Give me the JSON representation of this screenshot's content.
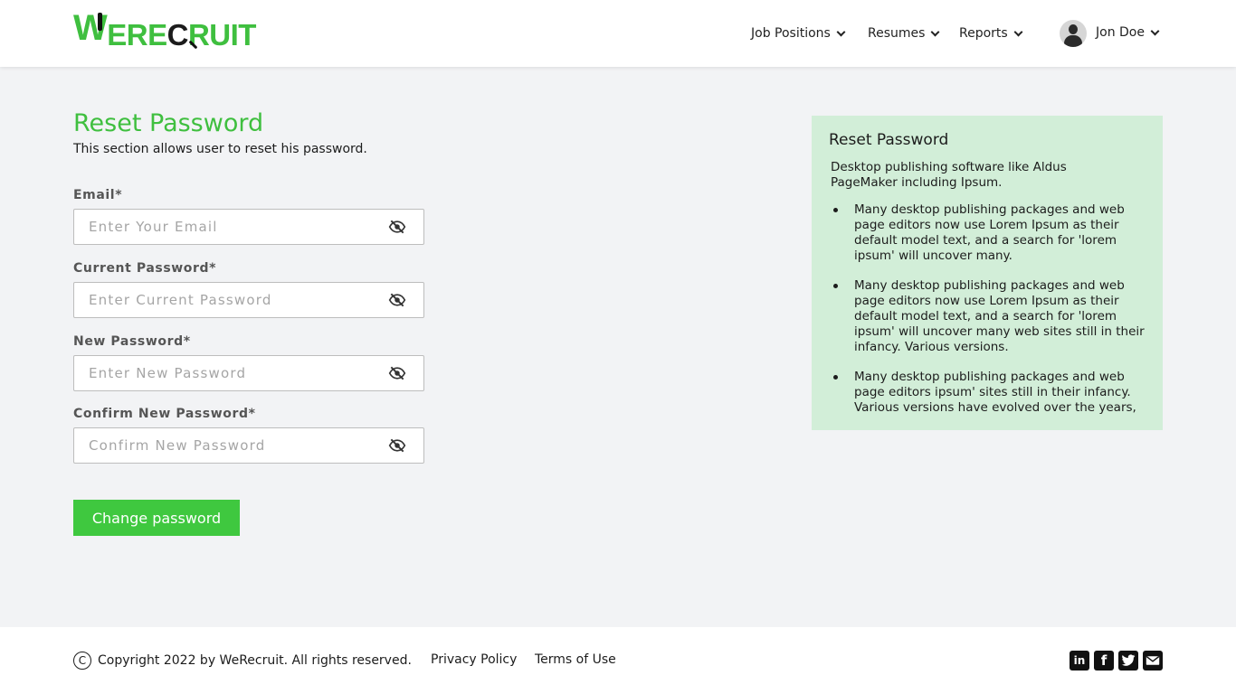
{
  "brand": {
    "logo_w": "W",
    "logo_e": "E",
    "logo_re": "RE",
    "logo_c": "C",
    "logo_ruit": "RUIT",
    "accent_color": "#3fbf3f"
  },
  "nav": {
    "items": [
      {
        "label": "Job Positions"
      },
      {
        "label": "Resumes"
      },
      {
        "label": "Reports"
      }
    ],
    "user_name": "Jon Doe"
  },
  "page": {
    "title": "Reset Password",
    "subtitle": "This section allows user to reset his password."
  },
  "form": {
    "fields": [
      {
        "label": "Email*",
        "placeholder": "Enter Your Email",
        "icon": "eye-slash-icon"
      },
      {
        "label": "Current Password*",
        "placeholder": "Enter Current Password",
        "icon": "eye-slash-icon"
      },
      {
        "label": "New Password*",
        "placeholder": "Enter New Password",
        "icon": "eye-slash-icon"
      },
      {
        "label": "Confirm New Password*",
        "placeholder": "Confirm New Password",
        "icon": "eye-slash-icon"
      }
    ],
    "submit_label": "Change password",
    "submit_color": "#3fc83f"
  },
  "info_panel": {
    "title": "Reset Password",
    "intro": "Desktop publishing software like Aldus PageMaker including Ipsum.",
    "bullets": [
      "Many desktop publishing packages and web page editors now use Lorem Ipsum as their default model text, and a search for 'lorem ipsum' will uncover many.",
      "Many desktop publishing packages and web page editors now use Lorem Ipsum as their default model text, and a search for 'lorem ipsum' will uncover many web sites still in their infancy. Various versions.",
      "Many desktop publishing packages and web page editors  ipsum' sites still in their infancy. Various versions have evolved over the years,"
    ],
    "background_color": "#d2eed8"
  },
  "footer": {
    "copyright_symbol": "C",
    "copyright": "Copyright 2022 by WeRecruit. All rights reserved.",
    "links": [
      "Privacy Policy",
      "Terms of Use"
    ],
    "social_icons": [
      "linkedin-icon",
      "facebook-icon",
      "twitter-icon",
      "email-icon"
    ],
    "social_glyphs": {
      "linkedin": "in",
      "facebook": "f"
    }
  }
}
